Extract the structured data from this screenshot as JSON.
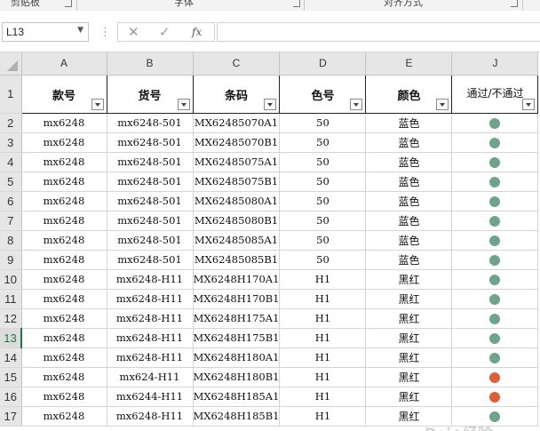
{
  "ribbon": {
    "groups": [
      "剪贴板",
      "字体",
      "对齐方式"
    ]
  },
  "formula_bar": {
    "name_box": "L13",
    "name_box_dropdown_icon": "chevron-down-icon",
    "cancel_icon": "close-icon",
    "enter_icon": "check-icon",
    "fx_label": "fx",
    "formula_value": ""
  },
  "columns": [
    "A",
    "B",
    "C",
    "D",
    "E",
    "J"
  ],
  "header_row": {
    "row_number": "1",
    "cells": [
      "款号",
      "货号",
      "条码",
      "色号",
      "颜色",
      "通过/不通过"
    ]
  },
  "rows": [
    {
      "n": "2",
      "a": "mx6248",
      "b": "mx6248-501",
      "c": "MX62485070A1",
      "d": "50",
      "e": "蓝色",
      "status": "pass"
    },
    {
      "n": "3",
      "a": "mx6248",
      "b": "mx6248-501",
      "c": "MX62485070B1",
      "d": "50",
      "e": "蓝色",
      "status": "pass"
    },
    {
      "n": "4",
      "a": "mx6248",
      "b": "mx6248-501",
      "c": "MX62485075A1",
      "d": "50",
      "e": "蓝色",
      "status": "pass"
    },
    {
      "n": "5",
      "a": "mx6248",
      "b": "mx6248-501",
      "c": "MX62485075B1",
      "d": "50",
      "e": "蓝色",
      "status": "pass"
    },
    {
      "n": "6",
      "a": "mx6248",
      "b": "mx6248-501",
      "c": "MX62485080A1",
      "d": "50",
      "e": "蓝色",
      "status": "pass"
    },
    {
      "n": "7",
      "a": "mx6248",
      "b": "mx6248-501",
      "c": "MX62485080B1",
      "d": "50",
      "e": "蓝色",
      "status": "pass"
    },
    {
      "n": "8",
      "a": "mx6248",
      "b": "mx6248-501",
      "c": "MX62485085A1",
      "d": "50",
      "e": "蓝色",
      "status": "pass"
    },
    {
      "n": "9",
      "a": "mx6248",
      "b": "mx6248-501",
      "c": "MX62485085B1",
      "d": "50",
      "e": "蓝色",
      "status": "pass"
    },
    {
      "n": "10",
      "a": "mx6248",
      "b": "mx6248-H11",
      "c": "MX6248H170A1",
      "d": "H1",
      "e": "黑红",
      "status": "pass"
    },
    {
      "n": "11",
      "a": "mx6248",
      "b": "mx6248-H11",
      "c": "MX6248H170B1",
      "d": "H1",
      "e": "黑红",
      "status": "pass"
    },
    {
      "n": "12",
      "a": "mx6248",
      "b": "mx6248-H11",
      "c": "MX6248H175A1",
      "d": "H1",
      "e": "黑红",
      "status": "pass"
    },
    {
      "n": "13",
      "a": "mx6248",
      "b": "mx6248-H11",
      "c": "MX6248H175B1",
      "d": "H1",
      "e": "黑红",
      "status": "pass"
    },
    {
      "n": "14",
      "a": "mx6248",
      "b": "mx6248-H11",
      "c": "MX6248H180A1",
      "d": "H1",
      "e": "黑红",
      "status": "pass"
    },
    {
      "n": "15",
      "a": "mx6248",
      "b": "mx624-H11",
      "c": "MX6248H180B1",
      "d": "H1",
      "e": "黑红",
      "status": "fail"
    },
    {
      "n": "16",
      "a": "mx6248",
      "b": "mx6244-H11",
      "c": "MX6248H185A1",
      "d": "H1",
      "e": "黑红",
      "status": "fail"
    },
    {
      "n": "17",
      "a": "mx6248",
      "b": "mx6248-H11",
      "c": "MX6248H185B1",
      "d": "H1",
      "e": "黑红",
      "status": "pass"
    }
  ],
  "selected_row": "13",
  "colors": {
    "pass": "#6fa48a",
    "fail": "#d9603b",
    "selected_accent": "#217346"
  }
}
